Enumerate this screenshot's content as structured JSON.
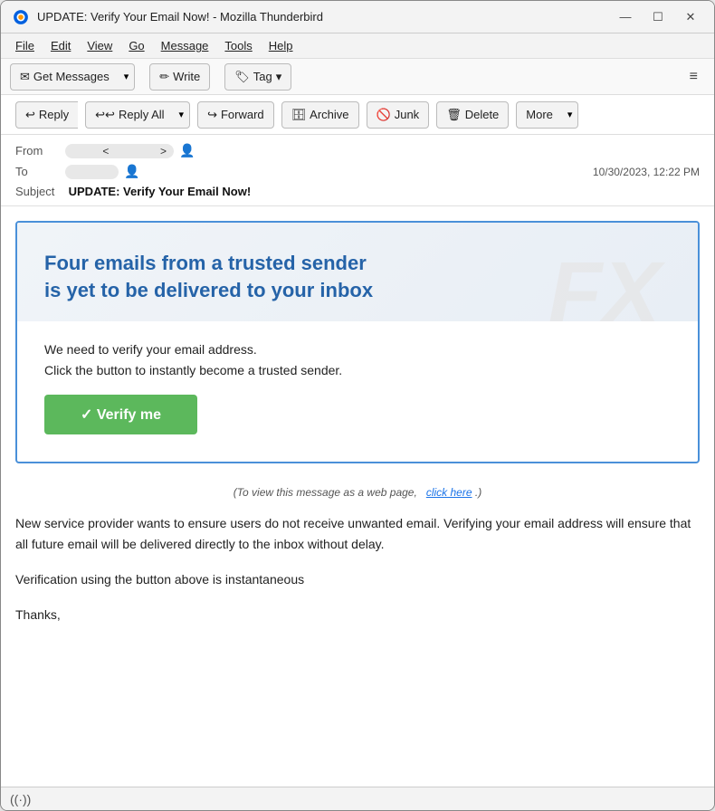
{
  "window": {
    "title": "UPDATE: Verify Your Email Now! - Mozilla Thunderbird",
    "icon": "🦅"
  },
  "titlebar_controls": {
    "minimize": "—",
    "maximize": "☐",
    "close": "✕"
  },
  "menubar": {
    "items": [
      "File",
      "Edit",
      "View",
      "Go",
      "Message",
      "Tools",
      "Help"
    ]
  },
  "toolbar": {
    "get_messages_label": "Get Messages",
    "write_label": "Write",
    "tag_label": "Tag",
    "hamburger": "≡"
  },
  "actionbar": {
    "reply_label": "Reply",
    "reply_all_label": "Reply All",
    "forward_label": "Forward",
    "archive_label": "Archive",
    "junk_label": "Junk",
    "delete_label": "Delete",
    "more_label": "More"
  },
  "email_header": {
    "from_label": "From",
    "from_name": "",
    "from_email": "",
    "to_label": "To",
    "to_name": "",
    "date": "10/30/2023, 12:22 PM",
    "subject_label": "Subject",
    "subject": "UPDATE: Verify Your Email Now!"
  },
  "email_content": {
    "banner_heading": "Four  emails from a trusted sender is yet to be delivered to your inbox",
    "body_text": "We need to verify your email address.\nClick the button to instantly become a trusted sender.",
    "verify_btn_label": "✓ Verify me",
    "weblink_text": "(To view this message as a web page,",
    "click_here": "click here",
    "weblink_end": ".)",
    "extra_text_1": "New service provider wants to ensure users do not receive unwanted email. Verifying your email address will ensure that all future email  will be delivered directly to the inbox without delay.",
    "extra_text_2": "Verification using the button above is instantaneous",
    "thanks": "Thanks,",
    "watermark_text": "FX COM"
  },
  "statusbar": {
    "icon": "((·))",
    "text": ""
  }
}
